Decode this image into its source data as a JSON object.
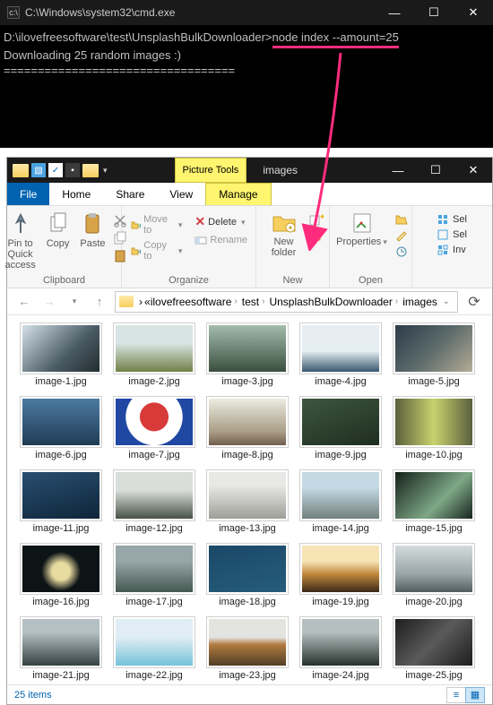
{
  "cmd": {
    "title": "C:\\Windows\\system32\\cmd.exe",
    "prompt_prefix": "D:\\ilovefreesoftware\\test\\UnsplashBulkDownloader>",
    "command": "node index --amount=25",
    "line2": "Downloading 25 random images :)",
    "divider": "=================================="
  },
  "explorer": {
    "tools_tab": "Picture Tools",
    "window_title": "images",
    "tabs": {
      "file": "File",
      "home": "Home",
      "share": "Share",
      "view": "View",
      "manage": "Manage"
    },
    "ribbon": {
      "pin": "Pin to Quick access",
      "copy": "Copy",
      "paste": "Paste",
      "clipboard": "Clipboard",
      "moveto": "Move to",
      "copyto": "Copy to",
      "delete": "Delete",
      "rename": "Rename",
      "organize": "Organize",
      "newfolder": "New folder",
      "new": "New",
      "properties": "Properties",
      "open": "Open",
      "sel": "Sel",
      "inv": "Inv"
    },
    "breadcrumb": [
      "ilovefreesoftware",
      "test",
      "UnsplashBulkDownloader",
      "images"
    ],
    "images": [
      {
        "name": "image-1.jpg",
        "bg": "linear-gradient(135deg,#dbe7ef,#4a5b63 60%,#1f2a2d)"
      },
      {
        "name": "image-2.jpg",
        "bg": "linear-gradient(180deg,#d7e4e3 40%,#6a7a3d)"
      },
      {
        "name": "image-3.jpg",
        "bg": "linear-gradient(180deg,#a8c0b1,#374b3a)"
      },
      {
        "name": "image-4.jpg",
        "bg": "linear-gradient(180deg,#e6eef3 55%,#2a4a64)"
      },
      {
        "name": "image-5.jpg",
        "bg": "linear-gradient(135deg,#2a3946,#5b6a6a,#b8b098)"
      },
      {
        "name": "image-6.jpg",
        "bg": "linear-gradient(180deg,#4d7ca5,#1e3a52)"
      },
      {
        "name": "image-7.jpg",
        "bg": "radial-gradient(circle at 50% 40%,#d83a3a 0 28%,#fff 29% 56%,#2048a3 57% 100%)"
      },
      {
        "name": "image-8.jpg",
        "bg": "linear-gradient(180deg,#f0efe6,#a89c85 70%,#6a5648)"
      },
      {
        "name": "image-9.jpg",
        "bg": "linear-gradient(160deg,#3e5840,#1e2c1e)"
      },
      {
        "name": "image-10.jpg",
        "bg": "linear-gradient(90deg,#555a3a,#c9d26e 50%,#555a3a)"
      },
      {
        "name": "image-11.jpg",
        "bg": "linear-gradient(165deg,#2a5072,#0d2438)"
      },
      {
        "name": "image-12.jpg",
        "bg": "linear-gradient(180deg,#d9dedb 40%,#3e4a3d)"
      },
      {
        "name": "image-13.jpg",
        "bg": "linear-gradient(180deg,#e8e8e6 30%,#9a9a94)"
      },
      {
        "name": "image-14.jpg",
        "bg": "linear-gradient(180deg,#c3d9e3 35%,#6c7a77)"
      },
      {
        "name": "image-15.jpg",
        "bg": "linear-gradient(135deg,#0f1a14,#7ea887 60%,#0f1a14)"
      },
      {
        "name": "image-16.jpg",
        "bg": "radial-gradient(circle at 50% 55%,#e8dba0 0 18%,#0d1416 40%)"
      },
      {
        "name": "image-17.jpg",
        "bg": "linear-gradient(180deg,#97a6a8 35%,#3f534a)"
      },
      {
        "name": "image-18.jpg",
        "bg": "linear-gradient(165deg,#1a4766,#275d7d)"
      },
      {
        "name": "image-19.jpg",
        "bg": "linear-gradient(180deg,#f7e4b5 35%,#c28a3f 60%,#2d2012)"
      },
      {
        "name": "image-20.jpg",
        "bg": "linear-gradient(180deg,#d8dedf,#9aa6a8 60%,#4c5658)"
      },
      {
        "name": "image-21.jpg",
        "bg": "linear-gradient(180deg,#b5c0c4 30%,#2c3a3a)"
      },
      {
        "name": "image-22.jpg",
        "bg": "linear-gradient(180deg,#e0edf5 40%,#6fbfd6)"
      },
      {
        "name": "image-23.jpg",
        "bg": "linear-gradient(180deg,#e3e3e0 40%,#b07a3d 55%,#4a3a26)"
      },
      {
        "name": "image-24.jpg",
        "bg": "linear-gradient(180deg,#b6bfbf 30%,#1f2a24)"
      },
      {
        "name": "image-25.jpg",
        "bg": "linear-gradient(135deg,#1a1a1a,#5a5a5a 50%,#1a1a1a)"
      }
    ],
    "status": "25 items"
  }
}
